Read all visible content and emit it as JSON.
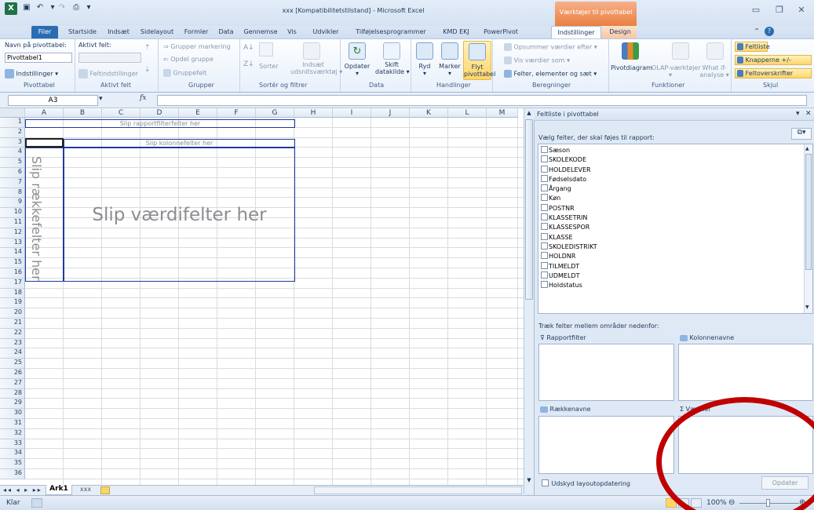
{
  "window": {
    "title": "xxx [Kompatibilitetstilstand] - Microsoft Excel",
    "context_header": "Værktøjer til pivottabel"
  },
  "tabs": [
    "Filer",
    "Startside",
    "Indsæt",
    "Sidelayout",
    "Formler",
    "Data",
    "Gennemse",
    "Vis",
    "Udvikler",
    "Tilføjelsesprogrammer",
    "KMD EKJ",
    "PowerPivot",
    "Indstillinger",
    "Design"
  ],
  "ribbon": {
    "pivottable": {
      "name_label": "Navn på pivottabel:",
      "name_value": "Pivottabel1",
      "options_btn": "Indstillinger",
      "group": "Pivottabel"
    },
    "active_field": {
      "label": "Aktivt felt:",
      "settings_btn": "Feltindstillinger",
      "group": "Aktivt felt"
    },
    "groups": {
      "group_selection": "Grupper markering",
      "ungroup": "Opdel gruppe",
      "group_field": "Gruppefelt",
      "group": "Grupper"
    },
    "sort": {
      "sort_btn": "Sorter",
      "slicer_line1": "Indsæt",
      "slicer_line2": "udsnitsværktøj",
      "group": "Sortér og filtrer"
    },
    "data": {
      "refresh": "Opdater",
      "change_line1": "Skift",
      "change_line2": "datakilde",
      "group": "Data"
    },
    "actions": {
      "clear": "Ryd",
      "select": "Marker",
      "move_line1": "Flyt",
      "move_line2": "pivottabel",
      "group": "Handlinger"
    },
    "calc": {
      "summarize": "Opsummer værdier efter",
      "show_values": "Vis værdier som",
      "fields_items": "Felter, elementer og sæt",
      "group": "Beregninger"
    },
    "tools": {
      "pivotchart": "Pivotdiagram",
      "olap": "OLAP-værktøjer",
      "whatif_line1": "What if-",
      "whatif_line2": "analyse",
      "group": "Funktioner"
    },
    "show": {
      "field_list": "Feltliste",
      "buttons": "Knapperne +/-",
      "headers": "Feltoverskrifter",
      "group": "Skjul"
    }
  },
  "formula": {
    "namebox": "A3",
    "fx": "fx"
  },
  "columns": [
    "A",
    "B",
    "C",
    "D",
    "E",
    "F",
    "G",
    "H",
    "I",
    "J",
    "K",
    "L",
    "M"
  ],
  "rows": [
    "1",
    "2",
    "3",
    "4",
    "5",
    "6",
    "7",
    "8",
    "9",
    "10",
    "11",
    "12",
    "13",
    "14",
    "15",
    "16",
    "17",
    "18",
    "19",
    "20",
    "21",
    "22",
    "23",
    "24",
    "25",
    "26",
    "27",
    "28",
    "29",
    "30",
    "31",
    "32",
    "33",
    "34",
    "35",
    "36"
  ],
  "pivot": {
    "report_filter_drop": "Slip rapportfilterfelter her",
    "column_drop": "Slip kolonnefelter her",
    "row_drop": "Slip rækkefelter her",
    "value_drop": "Slip værdifelter her"
  },
  "sheets": {
    "active": "Ark1",
    "other": "xxx"
  },
  "status": {
    "ready": "Klar",
    "zoom": "100%"
  },
  "fieldlist": {
    "title": "Feltliste i pivottabel",
    "choose_label": "Vælg felter, der skal føjes til rapport:",
    "fields": [
      "Sæson",
      "SKOLEKODE",
      "HOLDELEVER",
      "Fødselsdato",
      "Årgang",
      "Køn",
      "POSTNR",
      "KLASSETRIN",
      "KLASSESPOR",
      "KLASSE",
      "SKOLEDISTRIKT",
      "HOLDNR",
      "TILMELDT",
      "UDMELDT",
      "Holdstatus"
    ],
    "drag_label": "Træk felter mellem områder nedenfor:",
    "zones": {
      "report_filter": "Rapportfilter",
      "column_labels": "Kolonnenavne",
      "row_labels": "Rækkenavne",
      "values": "Værdier"
    },
    "defer_label": "Udskyd layoutopdatering",
    "update_btn": "Opdater"
  },
  "colors": {
    "accent": "#2b6cb3",
    "context": "#e9803f",
    "annotation": "#c00000",
    "pivot_border": "#1f3a9e"
  }
}
